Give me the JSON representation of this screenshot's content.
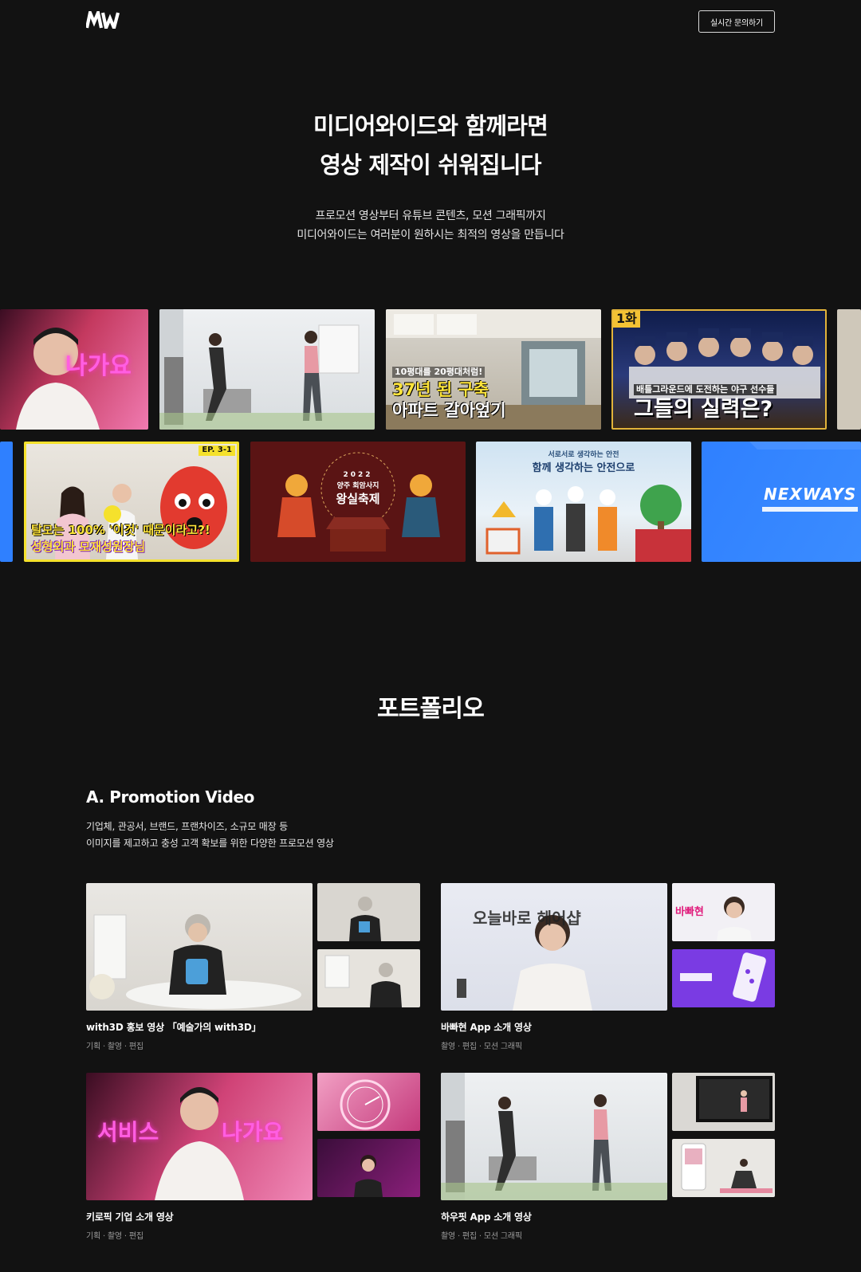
{
  "header": {
    "logo_text": "MW",
    "contact_button": "실시간 문의하기"
  },
  "hero": {
    "title_line1": "미디어와이드와 함께라면",
    "title_line2": "영상 제작이 쉬워집니다",
    "sub_line1": "프로모션 영상부터 유튜브 콘텐츠, 모션 그래픽까지",
    "sub_line2": "미디어와이드는 여러분이 원하시는 최적의 영상을 만듭니다"
  },
  "showcase": {
    "row1": [
      {
        "caption": "나가요"
      },
      {
        "caption": ""
      },
      {
        "caption_small": "10평대를 20평대처럼!",
        "caption_line1": "37년 된 구축",
        "caption_line2": "아파트 갈아엎기"
      },
      {
        "badge": "1화",
        "caption_small": "배틀그라운드에 도전하는 야구 선수들",
        "caption_line1": "그들의 실력은?"
      }
    ],
    "row2": [
      {
        "badge": "EP. 3-1",
        "caption_line1": "탈모는 100% '이것' 때문이라고?!",
        "caption_line2": "성형외과 모재성원장님"
      },
      {
        "caption_small": "2022",
        "caption_line1": "양주 회암사지",
        "caption_line2": "왕실축제"
      },
      {
        "caption_small": "서로서로 생각하는 안전",
        "caption_line1": "함께 생각하는 안전으로"
      },
      {
        "caption_line1": "NEXWAYS"
      }
    ]
  },
  "portfolio": {
    "section_title": "포트폴리오",
    "category": {
      "title": "A. Promotion Video",
      "desc_line1": "기업체, 관공서, 브랜드, 프랜차이즈, 소규모 매장 등",
      "desc_line2": "이미지를 제고하고 충성 고객 확보를 위한 다양한 프로모션 영상"
    },
    "items": [
      {
        "title": "with3D 홍보 영상 「예술가의 with3D」",
        "tags": "기획 · 촬영 · 편집"
      },
      {
        "title": "바빠현 App 소개 영상",
        "tags": "촬영 · 편집 · 모션 그래픽",
        "thumb_text": "오늘바로 헤어샵",
        "side_text": "바빠현"
      },
      {
        "title": "키로픽 기업 소개 영상",
        "tags": "기획 · 촬영 · 편집",
        "thumb_left": "서비스",
        "thumb_right": "나가요"
      },
      {
        "title": "하우핏 App 소개 영상",
        "tags": "촬영 · 편집 · 모션 그래픽"
      }
    ]
  },
  "colors": {
    "background": "#121212",
    "neon_pink": "#ff4fd8",
    "yellow": "#ffe53b",
    "accent_blue": "#2f80ff"
  }
}
